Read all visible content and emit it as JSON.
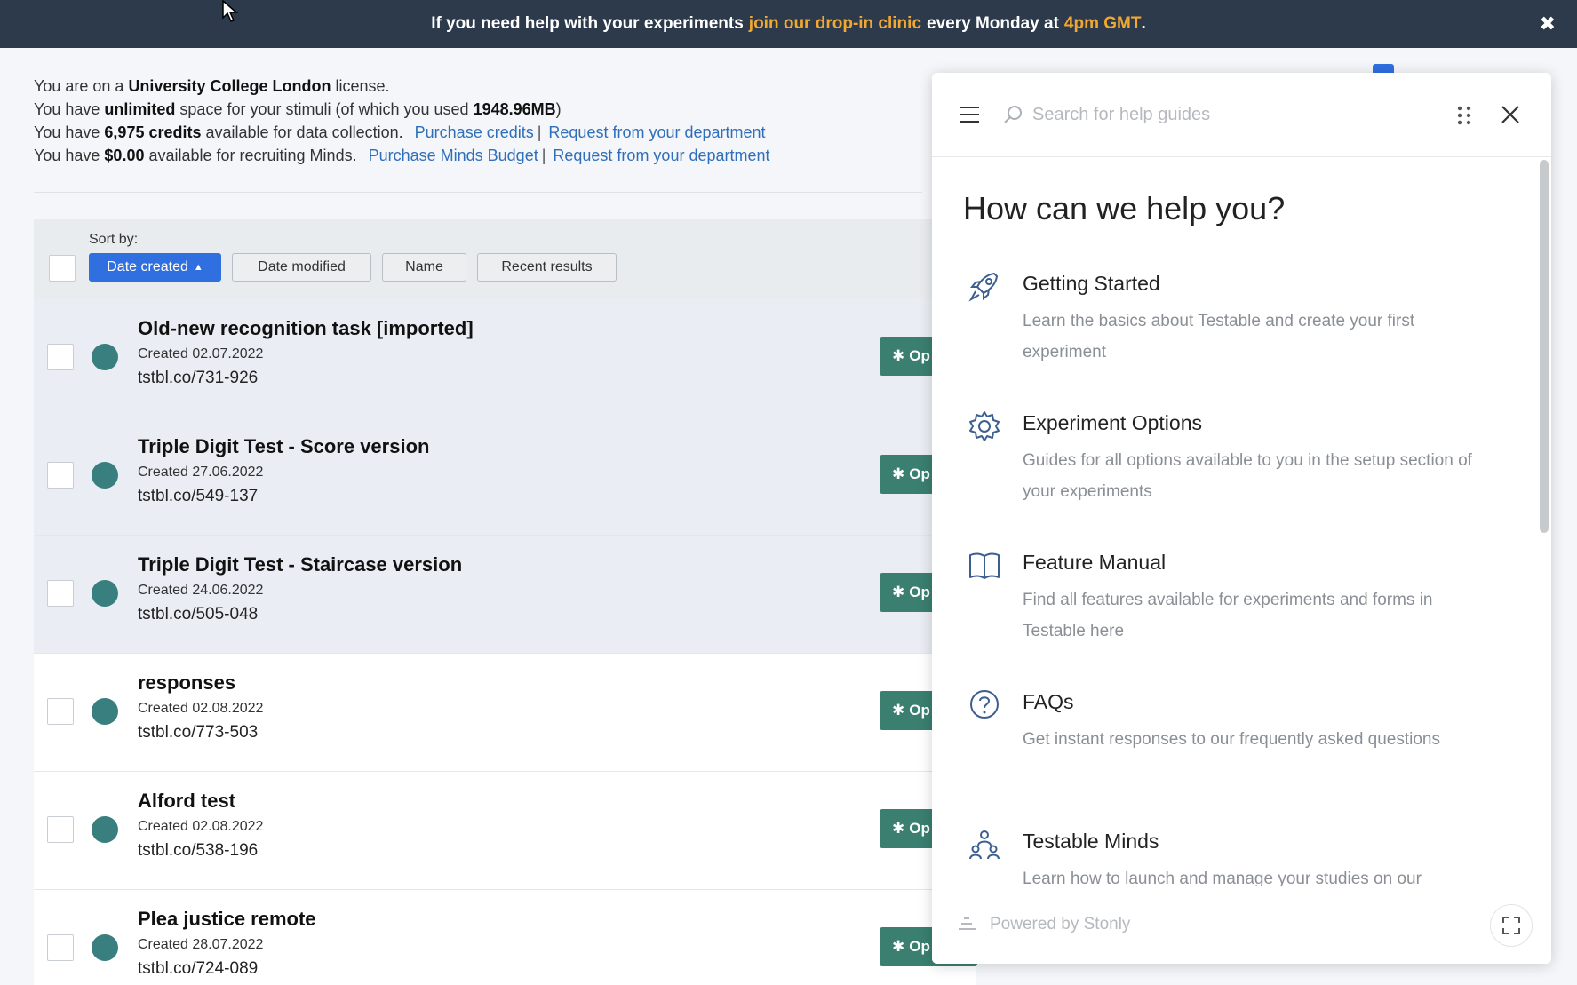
{
  "banner": {
    "text_before": "If you need help with your experiments ",
    "link": "join our drop-in clinic",
    "text_middle": " every Monday at ",
    "time": "4pm GMT",
    "text_after": ".",
    "close": "✖"
  },
  "license": {
    "line1_pre": "You are on a ",
    "line1_org": "University College London",
    "line1_post": " license.",
    "line2_pre": "You have ",
    "line2_bold": "unlimited",
    "line2_mid": " space for your stimuli (of which you used ",
    "line2_used": "1948.96MB",
    "line2_post": ")",
    "line3_pre": "You have ",
    "line3_bold": "6,975 credits",
    "line3_post": " available for data collection.",
    "purchase_credits": "Purchase credits",
    "request_dept_1": "Request from your department",
    "line4_pre": "You have ",
    "line4_bold": "$0.00",
    "line4_post": " available for recruiting Minds.",
    "purchase_minds": "Purchase Minds Budget",
    "request_dept_2": "Request from your department",
    "separator": "|"
  },
  "sort": {
    "label": "Sort by:",
    "date_created": "Date created",
    "date_modified": "Date modified",
    "name": "Name",
    "recent_results": "Recent results"
  },
  "experiments": [
    {
      "title": "Old-new recognition task [imported]",
      "created": "Created 02.07.2022",
      "link": "tstbl.co/731-926",
      "btn": "Op"
    },
    {
      "title": "Triple Digit Test - Score version",
      "created": "Created 27.06.2022",
      "link": "tstbl.co/549-137",
      "btn": "Op"
    },
    {
      "title": "Triple Digit Test - Staircase version",
      "created": "Created 24.06.2022",
      "link": "tstbl.co/505-048",
      "btn": "Op"
    },
    {
      "title": "responses",
      "created": "Created 02.08.2022",
      "link": "tstbl.co/773-503",
      "btn": "Op"
    },
    {
      "title": "Alford test",
      "created": "Created 02.08.2022",
      "link": "tstbl.co/538-196",
      "btn": "Op"
    },
    {
      "title": "Plea justice remote",
      "created": "Created 28.07.2022",
      "link": "tstbl.co/724-089",
      "btn": "Op"
    }
  ],
  "help": {
    "search_placeholder": "Search for help guides",
    "heading": "How can we help you?",
    "items": [
      {
        "icon": "rocket-icon",
        "title": "Getting Started",
        "desc": "Learn the basics about Testable and create your first experiment"
      },
      {
        "icon": "gear-icon",
        "title": "Experiment Options",
        "desc": "Guides for all options available to you in the setup section of your experiments"
      },
      {
        "icon": "book-icon",
        "title": "Feature Manual",
        "desc": "Find all features available for experiments and forms in Testable here"
      },
      {
        "icon": "question-icon",
        "title": "FAQs",
        "desc": "Get instant responses to our frequently asked questions"
      },
      {
        "icon": "people-icon",
        "title": "Testable Minds",
        "desc": "Learn how to launch and manage your studies on our"
      }
    ],
    "powered_by": "Powered by Stonly"
  },
  "colors": {
    "banner_bg": "#2d3a4b",
    "banner_highlight": "#f0a830",
    "primary_blue": "#2f6fe0",
    "status_dot": "#3a7f7f",
    "op_button": "#3a7f70",
    "link": "#2f6fba"
  }
}
